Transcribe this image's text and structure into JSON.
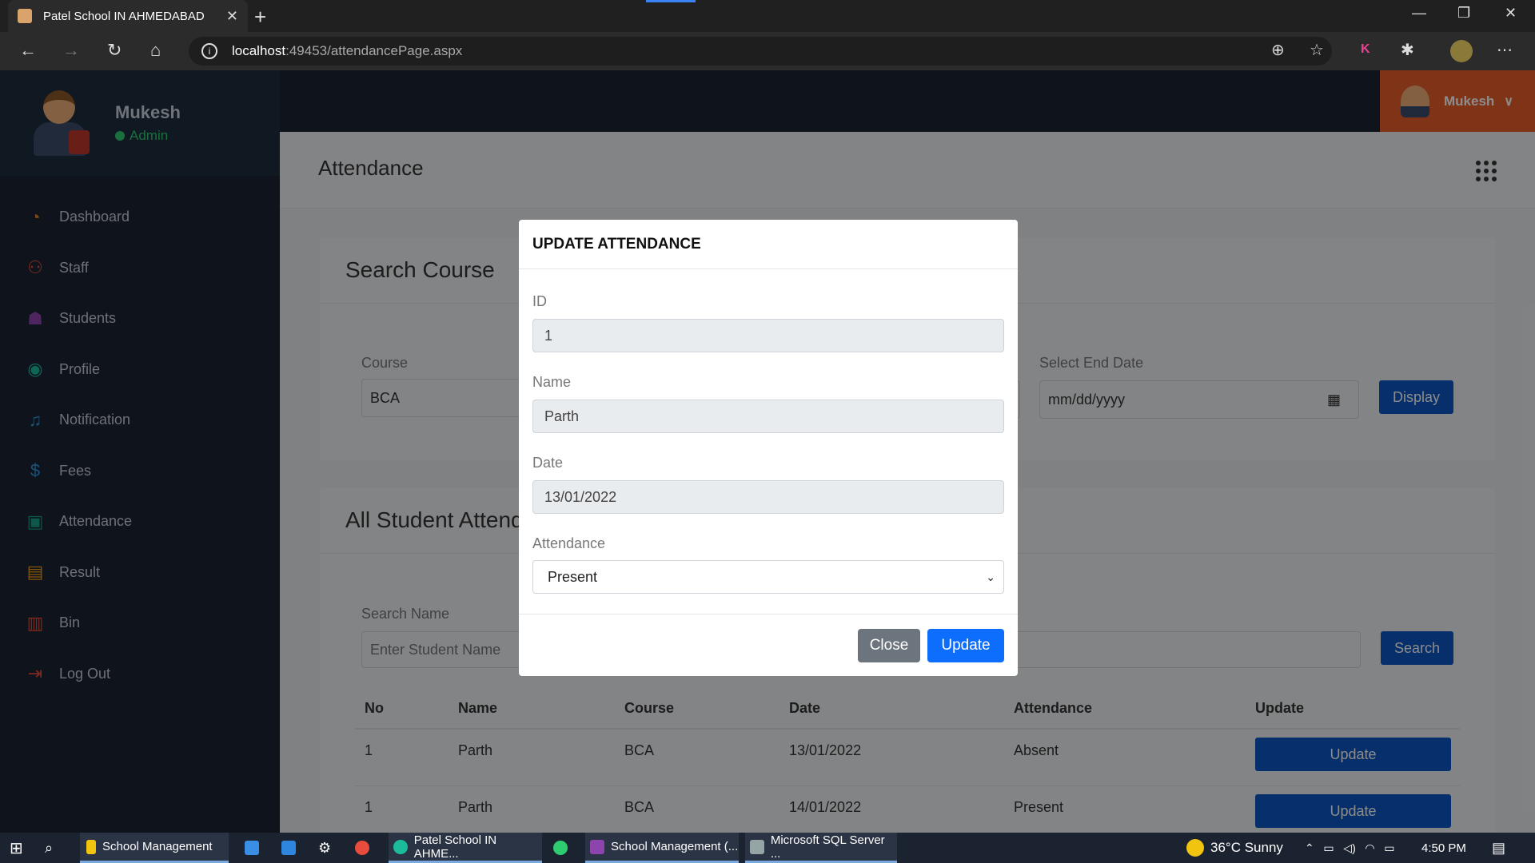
{
  "browser": {
    "tab_title": "Patel School IN AHMEDABAD",
    "tab_close": "✕",
    "new_tab": "+",
    "url_host": "localhost",
    "url_path": ":49453/attendancePage.aspx",
    "win_min": "—",
    "win_max": "❐",
    "win_close": "✕"
  },
  "sidebar": {
    "user_name": "Mukesh",
    "user_role": "Admin",
    "items": [
      {
        "label": "Dashboard",
        "icon": "dashboard-icon",
        "color": "#e67e22"
      },
      {
        "label": "Staff",
        "icon": "staff-icon",
        "color": "#e74c3c"
      },
      {
        "label": "Students",
        "icon": "students-icon",
        "color": "#8e44ad"
      },
      {
        "label": "Profile",
        "icon": "profile-icon",
        "color": "#1abc9c"
      },
      {
        "label": "Notification",
        "icon": "bell-icon",
        "color": "#3498db"
      },
      {
        "label": "Fees",
        "icon": "dollar-icon",
        "color": "#3498db"
      },
      {
        "label": "Attendance",
        "icon": "calendar-icon",
        "color": "#16a085"
      },
      {
        "label": "Result",
        "icon": "clipboard-icon",
        "color": "#f39c12"
      },
      {
        "label": "Bin",
        "icon": "trash-icon",
        "color": "#e74c3c"
      },
      {
        "label": "Log Out",
        "icon": "logout-icon",
        "color": "#e74c3c"
      }
    ]
  },
  "topbar": {
    "user": "Mukesh"
  },
  "page": {
    "title": "Attendance"
  },
  "search_course": {
    "heading": "Search Course",
    "course_label": "Course",
    "course_value": "BCA",
    "end_date_label": "Select End Date",
    "end_date_placeholder": "mm/dd/yyyy",
    "display_button": "Display"
  },
  "all_students": {
    "heading": "All Student Attendance",
    "search_label": "Search Name",
    "search_placeholder": "Enter Student Name",
    "search_button": "Search",
    "columns": [
      "No",
      "Name",
      "Course",
      "Date",
      "Attendance",
      "Update"
    ],
    "rows": [
      {
        "no": "1",
        "name": "Parth",
        "course": "BCA",
        "date": "13/01/2022",
        "attendance": "Absent",
        "update": "Update"
      },
      {
        "no": "1",
        "name": "Parth",
        "course": "BCA",
        "date": "14/01/2022",
        "attendance": "Present",
        "update": "Update"
      }
    ]
  },
  "modal": {
    "title": "UPDATE ATTENDANCE",
    "id_label": "ID",
    "id_value": "1",
    "name_label": "Name",
    "name_value": "Parth",
    "date_label": "Date",
    "date_value": "13/01/2022",
    "attendance_label": "Attendance",
    "attendance_value": "Present",
    "close_button": "Close",
    "update_button": "Update"
  },
  "taskbar": {
    "items": [
      "School Management",
      "Patel School IN AHME...",
      "School Management (...",
      "Microsoft SQL Server ..."
    ],
    "weather": "36°C  Sunny",
    "time": "4:50 PM"
  },
  "colors": {
    "accent": "#0b57c3",
    "modal_update": "#0d6efd",
    "close_btn": "#6c757d",
    "user_btn": "#e8602c"
  }
}
